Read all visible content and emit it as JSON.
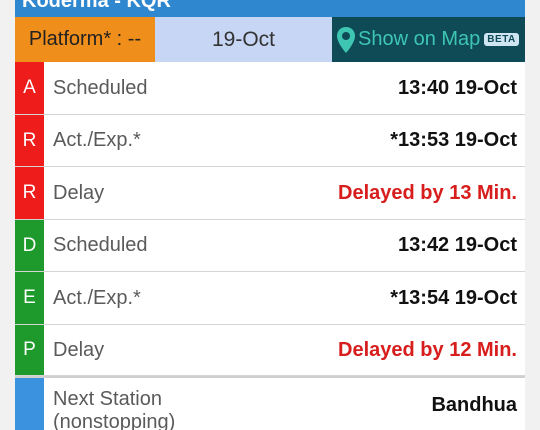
{
  "title": "Koderma - KQR",
  "platform": {
    "label": "Platform* : --"
  },
  "date": "19-Oct",
  "map_button": {
    "label": "Show on Map",
    "badge": "BETA",
    "icon": "map-pin-icon"
  },
  "colors": {
    "header": "#2f87cf",
    "platform_bg": "#f08e1b",
    "date_bg": "#c7d6f5",
    "map_bg": "#0f4a57",
    "arrival": "#ef1c1c",
    "departure": "#1d9a2b",
    "next": "#3b93e0",
    "delay_text": "#d81d1d"
  },
  "arrival": {
    "rows": [
      {
        "letter": "A",
        "label": "Scheduled",
        "value": "13:40 19-Oct"
      },
      {
        "letter": "R",
        "label": "Act./Exp.*",
        "value": "*13:53 19-Oct"
      },
      {
        "letter": "R",
        "label": "Delay",
        "value": "Delayed by 13 Min."
      }
    ]
  },
  "departure": {
    "rows": [
      {
        "letter": "D",
        "label": "Scheduled",
        "value": "13:42 19-Oct"
      },
      {
        "letter": "E",
        "label": "Act./Exp.*",
        "value": "*13:54 19-Oct"
      },
      {
        "letter": "P",
        "label": "Delay",
        "value": "Delayed by 12 Min."
      }
    ]
  },
  "next_station": {
    "label_line1": "Next Station",
    "label_line2": "(nonstopping)",
    "value": "Bandhua"
  }
}
